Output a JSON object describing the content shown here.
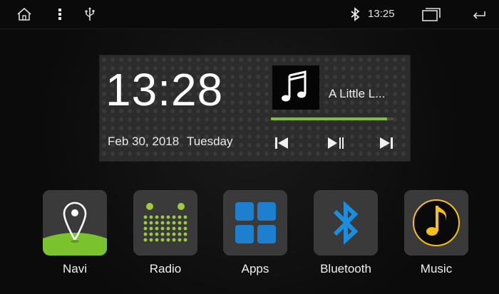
{
  "status_bar": {
    "time": "13:25",
    "icons": [
      "home-icon",
      "more-vertical-icon",
      "usb-icon",
      "bluetooth-icon",
      "recent-apps-icon",
      "back-icon"
    ]
  },
  "clock_widget": {
    "time": "13:28",
    "date": "Feb 30, 2018",
    "weekday": "Tuesday"
  },
  "media": {
    "song_title": "A Little L...",
    "album_icon": "music-note-icon",
    "progress": 0.95,
    "controls": [
      "previous-icon",
      "play-pause-icon",
      "next-icon"
    ],
    "accent_color": "#7fc22b"
  },
  "apps": [
    {
      "label": "Navi",
      "icon": "map-pin-icon"
    },
    {
      "label": "Radio",
      "icon": "radio-dots-icon"
    },
    {
      "label": "Apps",
      "icon": "grid-icon"
    },
    {
      "label": "Bluetooth",
      "icon": "bluetooth-icon"
    },
    {
      "label": "Music",
      "icon": "music-note-icon"
    }
  ],
  "colors": {
    "background": "#0a0a0a",
    "widget": "#2c2c2c",
    "tile": "#3a3a3a",
    "navi_green": "#7bc32e",
    "radio_green": "#9ccc3a",
    "apps_blue": "#1e7fd1",
    "bluetooth_blue": "#1a8ee0",
    "music_yellow": "#f2c21b"
  }
}
